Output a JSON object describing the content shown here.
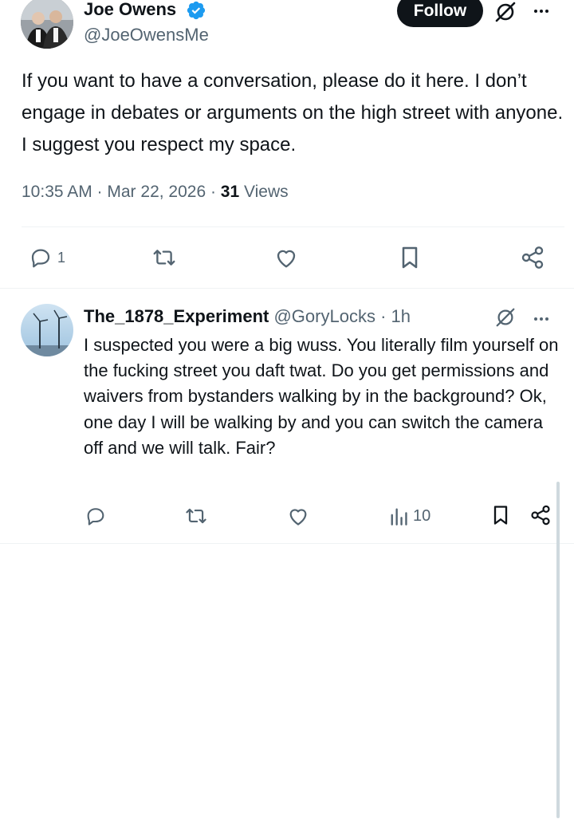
{
  "tweet": {
    "author_name": "Joe Owens",
    "author_handle": "@JoeOwensMe",
    "follow_label": "Follow",
    "text": "If you want to have a conversation, please do it here. I don’t engage in debates or arguments on the high street with anyone. I suggest you respect my space.",
    "time": "10:35 AM · Mar 22, 2026 · ",
    "views_count": "31",
    "views_label": " Views",
    "actions": {
      "reply_count": "1",
      "repost_icon": "repost-icon",
      "like_icon": "heart-icon",
      "bookmark_icon": "bookmark-icon",
      "share_icon": "share-icon"
    },
    "verified_color": "#1d9bf0"
  },
  "reply": {
    "author_name": "The_1878_Experiment",
    "author_handle": "@GoryLocks",
    "separator": " · ",
    "time": "1h",
    "text": "I suspected you were a big wuss. You literally film yourself on the fucking street you daft twat. Do you get permissions and waivers from bystanders walking by in the background? Ok, one day I will be walking by and you can switch the camera off and we will talk. Fair?",
    "views_count": "10"
  },
  "colors": {
    "text": "#0f1419",
    "muted": "#536471",
    "divider": "#eff3f4",
    "follow_bg": "#0f1419"
  }
}
